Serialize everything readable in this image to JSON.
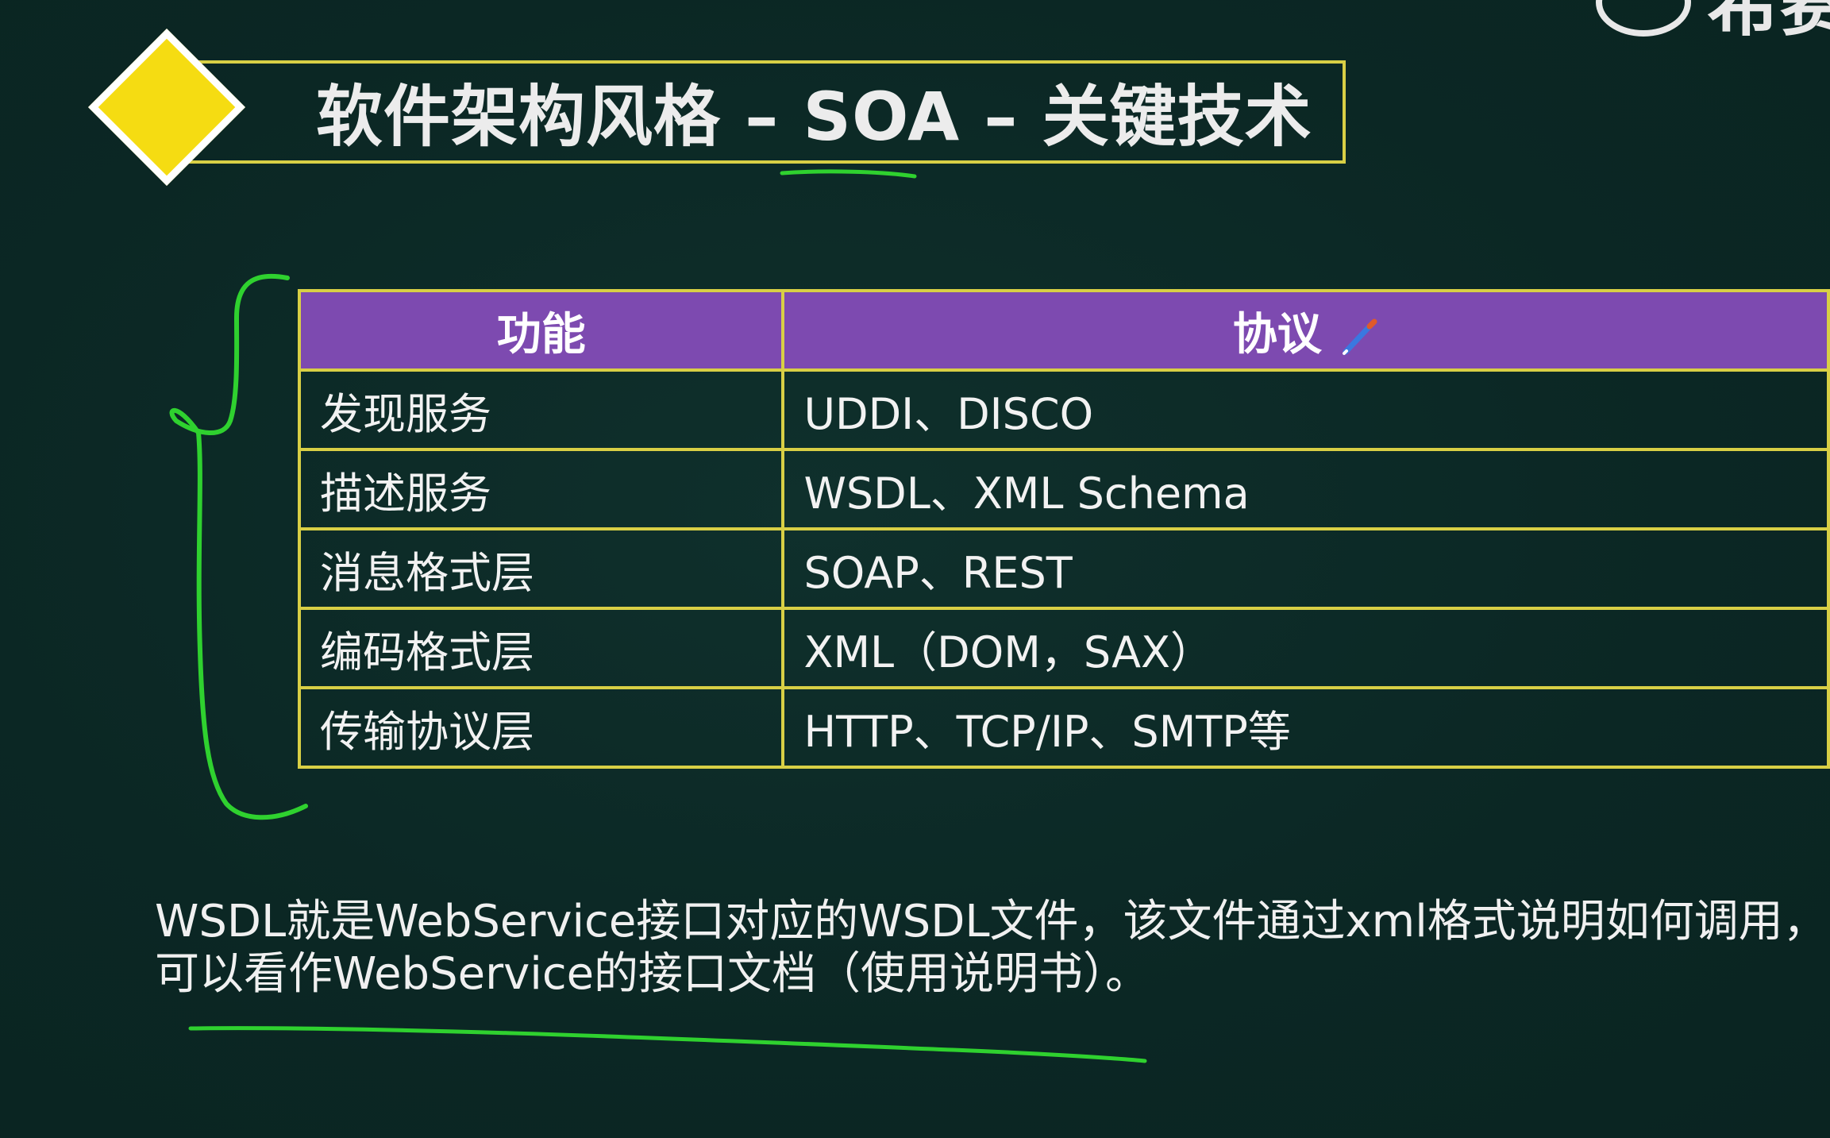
{
  "title": "软件架构风格 – SOA – 关键技术",
  "logo": {
    "text": "希赛"
  },
  "table": {
    "headers": [
      "功能",
      "协议"
    ],
    "rows": [
      {
        "function": "发现服务",
        "protocol": "UDDI、DISCO"
      },
      {
        "function": "描述服务",
        "protocol": "WSDL、XML Schema"
      },
      {
        "function": "消息格式层",
        "protocol": "SOAP、REST"
      },
      {
        "function": "编码格式层",
        "protocol": "XML（DOM，SAX）"
      },
      {
        "function": "传输协议层",
        "protocol": "HTTP、TCP/IP、SMTP等"
      }
    ]
  },
  "note": {
    "line1": "WSDL就是WebService接口对应的WSDL文件，该文件通过xml格式说明如何调用，",
    "line2": "可以看作WebService的接口文档（使用说明书）。"
  },
  "colors": {
    "background": "#0b2724",
    "accent_yellow": "#f5dc12",
    "border_yellow": "#d8cf45",
    "header_purple": "#7d4ab0",
    "annotation_green": "#2fd12f"
  }
}
